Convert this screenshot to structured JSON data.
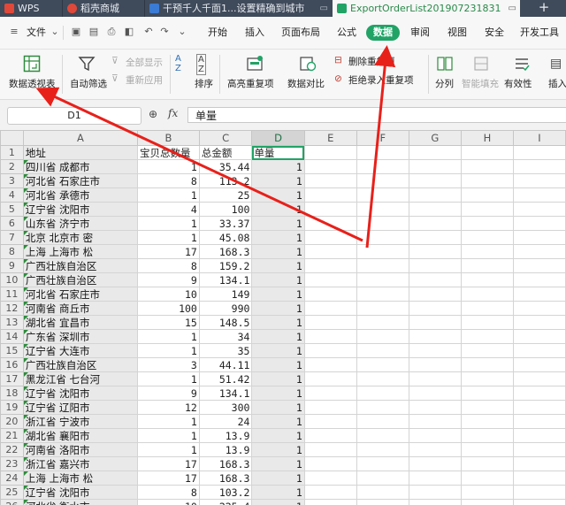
{
  "tabs": [
    {
      "label": "WPS",
      "color": "#e0483a"
    },
    {
      "label": "稻壳商城",
      "color": "#e0483a"
    },
    {
      "label": "干预千人千面1...设置精确到城市",
      "color": "#3a7bd5"
    },
    {
      "label": "ExportOrderList201907231831",
      "color": "#21a366"
    }
  ],
  "tab_add": "+",
  "menu": {
    "file": "文件",
    "items": [
      "开始",
      "插入",
      "页面布局",
      "公式",
      "数据",
      "审阅",
      "视图",
      "安全",
      "开发工具"
    ],
    "active": "数据",
    "accent": "#21a366"
  },
  "ribbon": {
    "pivot": "数据透视表",
    "autofilter": "自动筛选",
    "show_all": "全部显示",
    "reapply": "重新应用",
    "sort": "排序",
    "highlight_dup": "高亮重复项",
    "compare": "数据对比",
    "remove_dup": "删除重复项",
    "reject_dup": "拒绝录入重复项",
    "split": "分列",
    "smart_fill": "智能填充",
    "validity": "有效性",
    "insert": "插入"
  },
  "formula_bar": {
    "cell_ref": "D1",
    "fx": "fx",
    "content": "单量"
  },
  "sheet": {
    "columns": [
      "A",
      "B",
      "C",
      "D",
      "E",
      "F",
      "G",
      "H",
      "I"
    ],
    "header": [
      "地址",
      "宝贝总数量",
      "总金额",
      "单量"
    ],
    "rows": [
      [
        "四川省 成都市",
        "1",
        "35.44",
        "1"
      ],
      [
        "河北省 石家庄市",
        "8",
        "113.2",
        "1"
      ],
      [
        "河北省 承德市",
        "1",
        "25",
        "1"
      ],
      [
        "辽宁省 沈阳市",
        "4",
        "100",
        "1"
      ],
      [
        "山东省 济宁市",
        "1",
        "33.37",
        "1"
      ],
      [
        "北京 北京市 密",
        "1",
        "45.08",
        "1"
      ],
      [
        "上海 上海市 松",
        "17",
        "168.3",
        "1"
      ],
      [
        "广西壮族自治区",
        "8",
        "159.2",
        "1"
      ],
      [
        "广西壮族自治区",
        "9",
        "134.1",
        "1"
      ],
      [
        "河北省 石家庄市",
        "10",
        "149",
        "1"
      ],
      [
        "河南省 商丘市",
        "100",
        "990",
        "1"
      ],
      [
        "湖北省 宜昌市",
        "15",
        "148.5",
        "1"
      ],
      [
        "广东省 深圳市",
        "1",
        "34",
        "1"
      ],
      [
        "辽宁省 大连市",
        "1",
        "35",
        "1"
      ],
      [
        "广西壮族自治区",
        "3",
        "44.11",
        "1"
      ],
      [
        "黑龙江省 七台河",
        "1",
        "51.42",
        "1"
      ],
      [
        "辽宁省 沈阳市",
        "9",
        "134.1",
        "1"
      ],
      [
        "辽宁省 辽阳市",
        "12",
        "300",
        "1"
      ],
      [
        "浙江省 宁波市",
        "1",
        "24",
        "1"
      ],
      [
        "湖北省 襄阳市",
        "1",
        "13.9",
        "1"
      ],
      [
        "河南省 洛阳市",
        "1",
        "13.9",
        "1"
      ],
      [
        "浙江省 嘉兴市",
        "17",
        "168.3",
        "1"
      ],
      [
        "上海 上海市 松",
        "17",
        "168.3",
        "1"
      ],
      [
        "辽宁省 沈阳市",
        "8",
        "103.2",
        "1"
      ],
      [
        "河北省 衡水市",
        "10",
        "225.4",
        "1"
      ],
      [
        "河北省 唐山市",
        "1",
        "13.9",
        "1"
      ]
    ]
  },
  "arrow_color": "#e8201a"
}
